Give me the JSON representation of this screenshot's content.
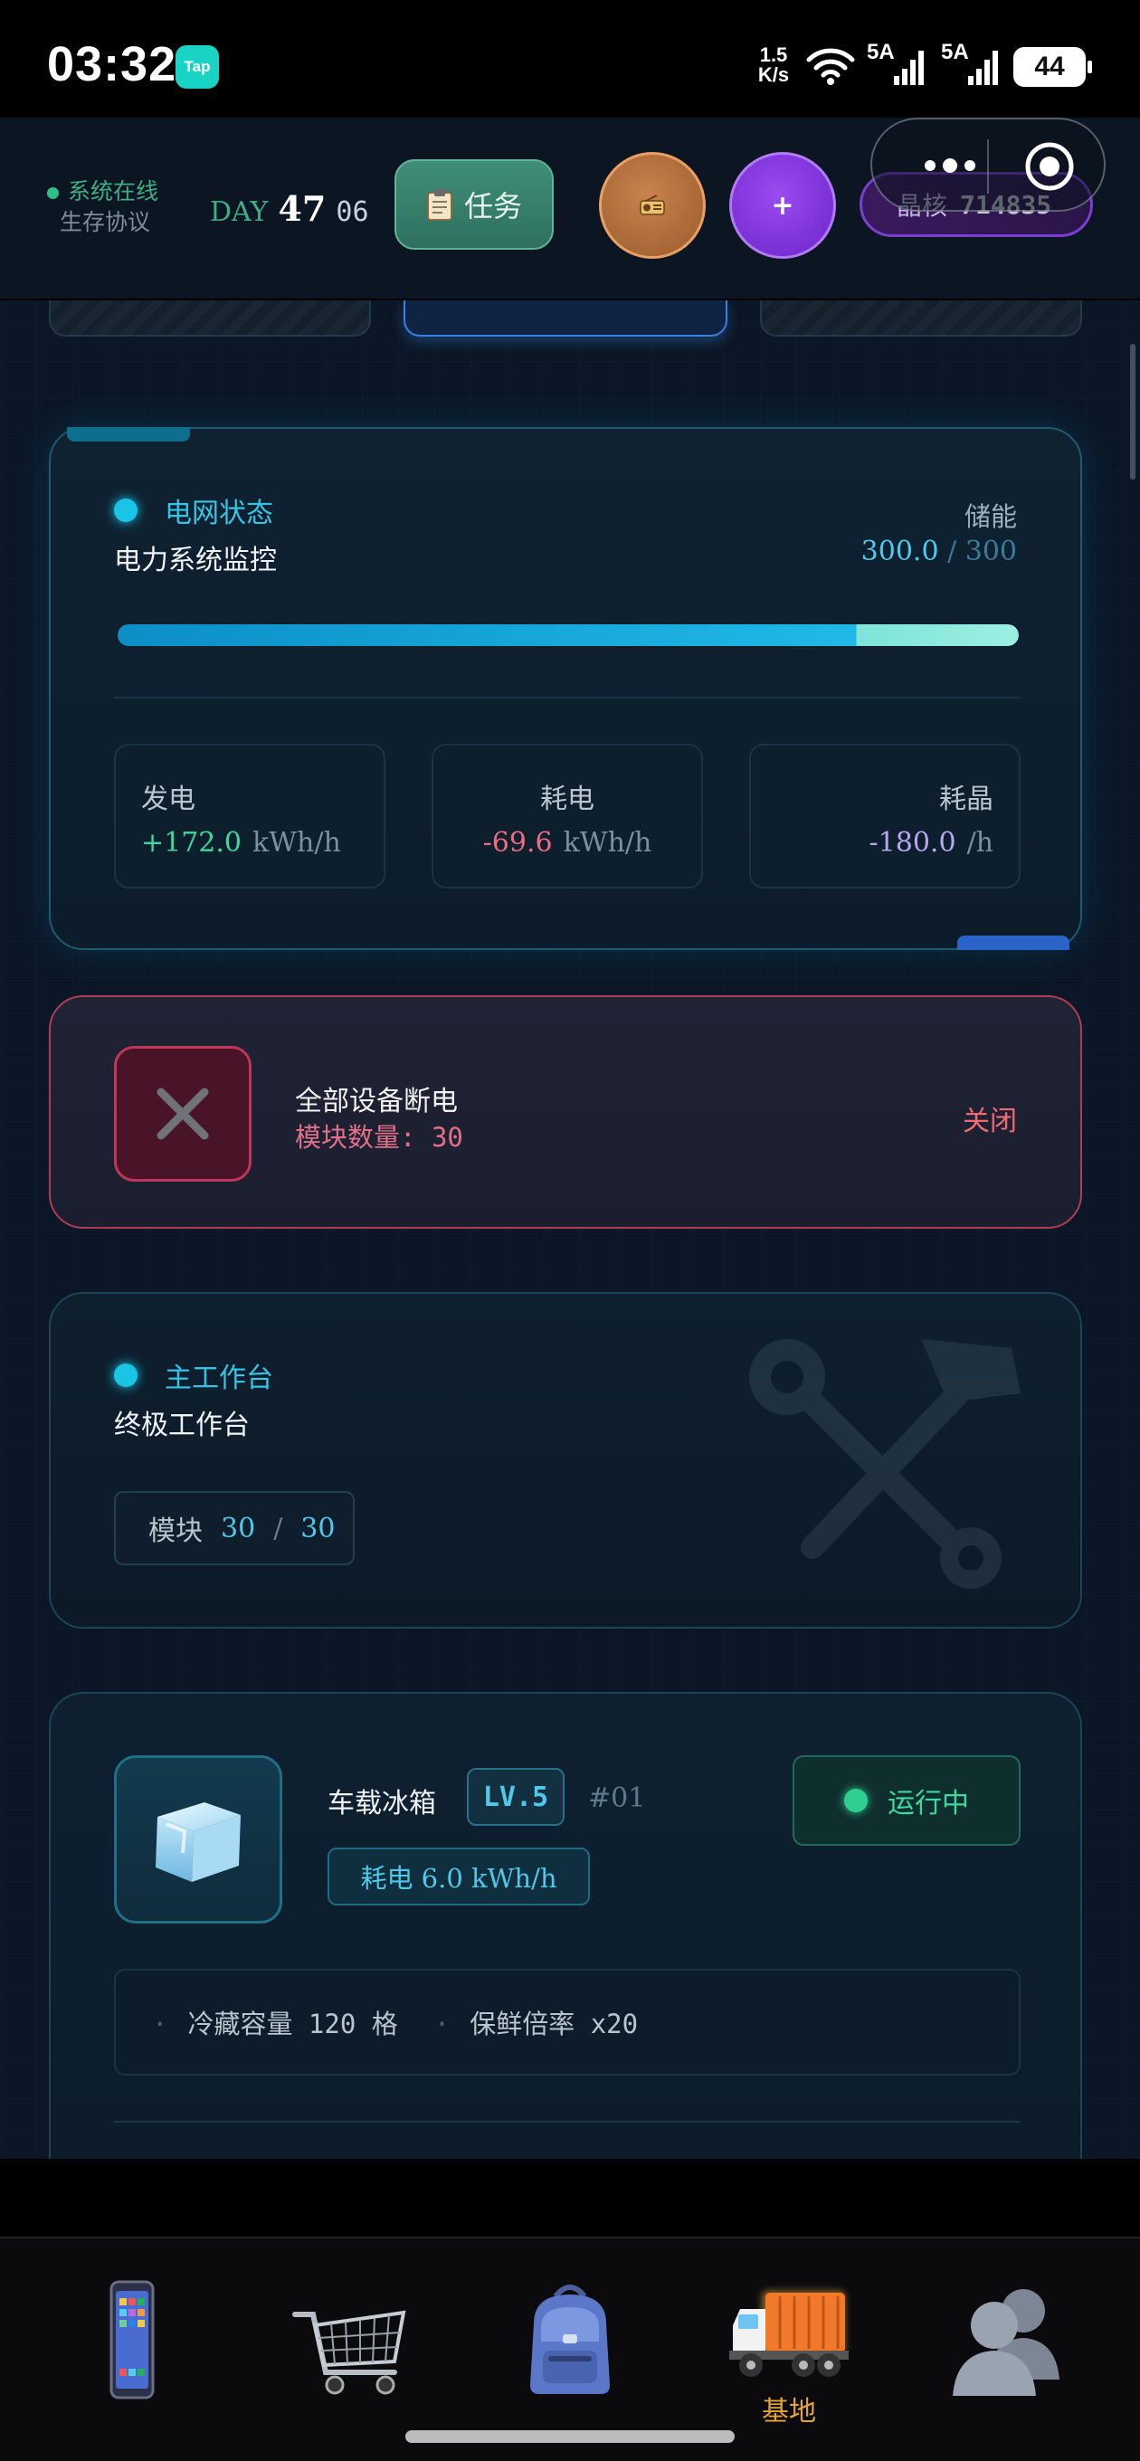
{
  "status_bar": {
    "time": "03:32",
    "app_badge": "Tap",
    "net_speed_value": "1.5",
    "net_speed_unit": "K/s",
    "signal_1": "5A",
    "signal_2": "5A",
    "battery": "44"
  },
  "header": {
    "online_label": "系统在线",
    "protocol_label": "生存协议",
    "day_label": "DAY",
    "day_number": "47",
    "day_sub": "06",
    "task_label": "任务",
    "plus_label": "+",
    "crystal_label": "晶核",
    "crystal_value": "714835"
  },
  "grid": {
    "title": "电网状态",
    "subtitle": "电力系统监控",
    "storage_label": "储能",
    "storage_current": "300.0",
    "storage_max": "/ 300",
    "storage_fraction": 1.0,
    "generation_label": "发电",
    "generation_value": "+172.0",
    "generation_unit": "kWh/h",
    "consumption_label": "耗电",
    "consumption_value": "-69.6",
    "consumption_unit": "kWh/h",
    "crystal_use_label": "耗晶",
    "crystal_use_value": "-180.0",
    "crystal_use_unit": "/h"
  },
  "poweroff": {
    "title": "全部设备断电",
    "module_label": "模块数量:",
    "module_count": "30",
    "close_label": "关闭"
  },
  "workbench": {
    "title": "主工作台",
    "subtitle": "终极工作台",
    "module_label": "模块",
    "module_current": "30",
    "module_sep": "/",
    "module_max": "30"
  },
  "fridge": {
    "name": "车载冰箱",
    "level": "LV.5",
    "id": "#01",
    "power": "耗电 6.0 kWh/h",
    "status": "运行中",
    "spec_1": "冷藏容量 120 格",
    "spec_2": "保鲜倍率 x20"
  },
  "bottom_nav": {
    "active_label": "基地"
  },
  "colors": {
    "accent_cyan": "#19c4e6",
    "positive_green": "#3fd8a0",
    "negative_red": "#e0708a",
    "crystal_purple": "#b5a8f0",
    "nav_active": "#e4a43a"
  }
}
